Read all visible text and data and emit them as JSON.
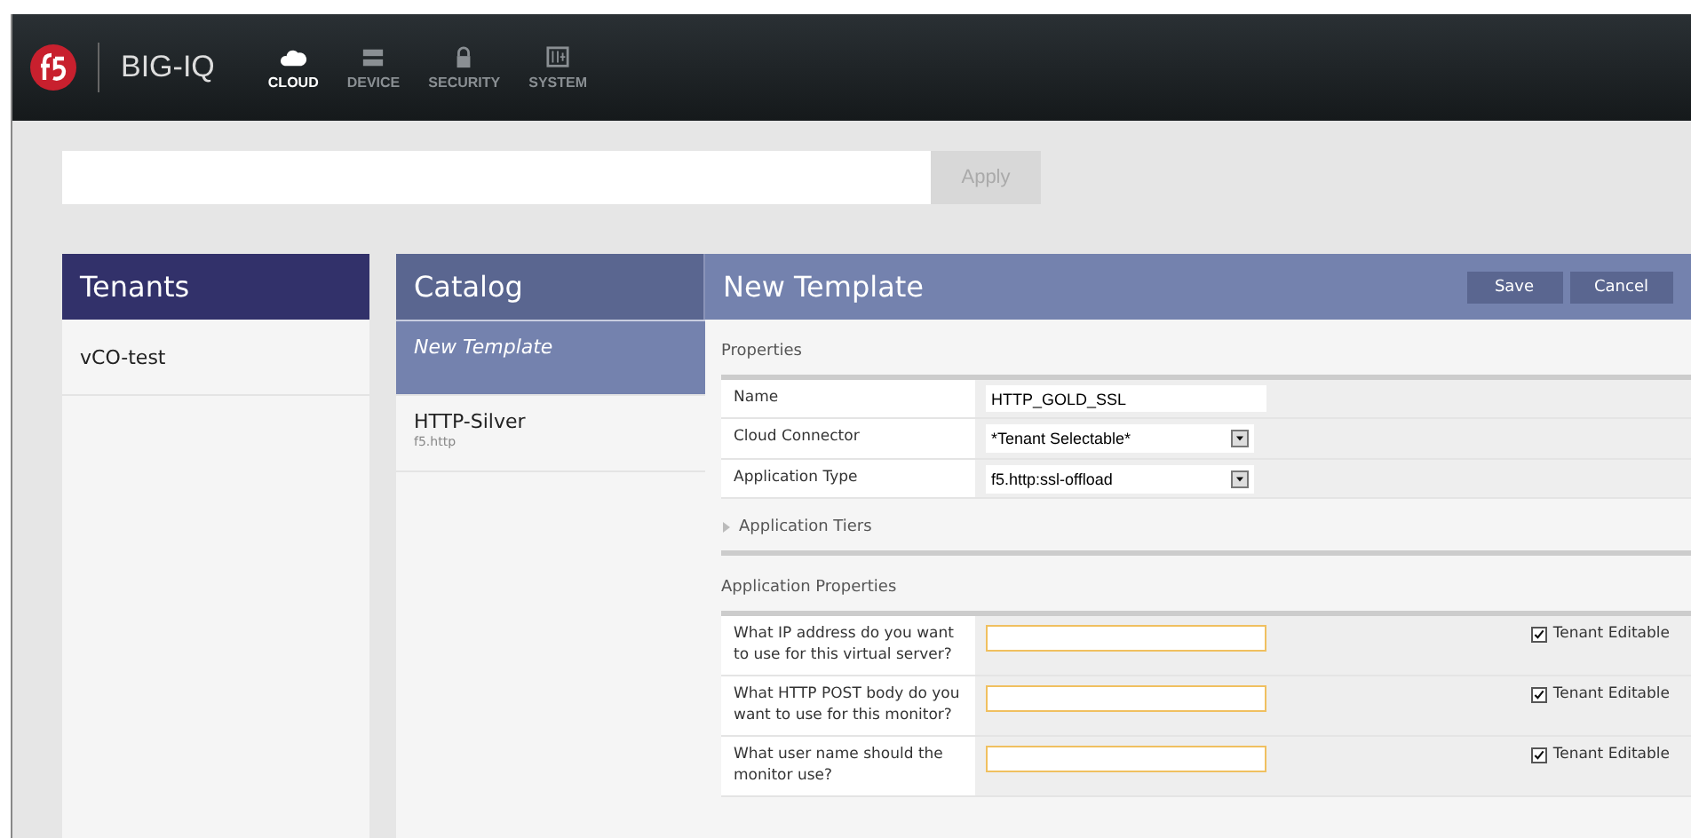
{
  "header": {
    "product": "BIG-IQ",
    "nav": [
      {
        "label": "CLOUD",
        "kind": "cloud",
        "selected": true
      },
      {
        "label": "DEVICE",
        "kind": "device",
        "selected": false
      },
      {
        "label": "SECURITY",
        "kind": "security",
        "selected": false
      },
      {
        "label": "SYSTEM",
        "kind": "system",
        "selected": false
      }
    ]
  },
  "filter": {
    "apply": {
      "label": "Apply",
      "disabled": true
    }
  },
  "tenants": {
    "title": "Tenants",
    "items": [
      {
        "name": "vCO-test",
        "selected": false
      }
    ]
  },
  "catalog": {
    "title": "Catalog",
    "items": [
      {
        "name": "New Template",
        "selected": true
      },
      {
        "name": "HTTP-Silver",
        "subtitle": "f5.http",
        "selected": false
      }
    ]
  },
  "template": {
    "title": "New Template",
    "buttons": [
      "Save",
      "Cancel"
    ],
    "properties": {
      "title": "Properties",
      "rows": [
        {
          "label": "Name",
          "kind": "text",
          "value": "HTTP_GOLD_SSL"
        },
        {
          "label": "Cloud Connector",
          "kind": "select",
          "value": "*Tenant Selectable*"
        },
        {
          "label": "Application Type",
          "kind": "select",
          "value": "f5.http:ssl-offload"
        }
      ]
    },
    "tiers": {
      "title": "Application Tiers",
      "expanded": false
    },
    "app_properties": {
      "title": "Application Properties",
      "rows": [
        {
          "label": "What IP address do you want to use for this virtual server?",
          "value": "",
          "editable_label": "Tenant Editable",
          "checked": true
        },
        {
          "label": "What HTTP POST body do you want to use for this monitor?",
          "value": "",
          "editable_label": "Tenant Editable",
          "checked": true
        },
        {
          "label": "What user name should the monitor use?",
          "value": "",
          "editable_label": "Tenant Editable",
          "checked": true
        }
      ]
    }
  }
}
